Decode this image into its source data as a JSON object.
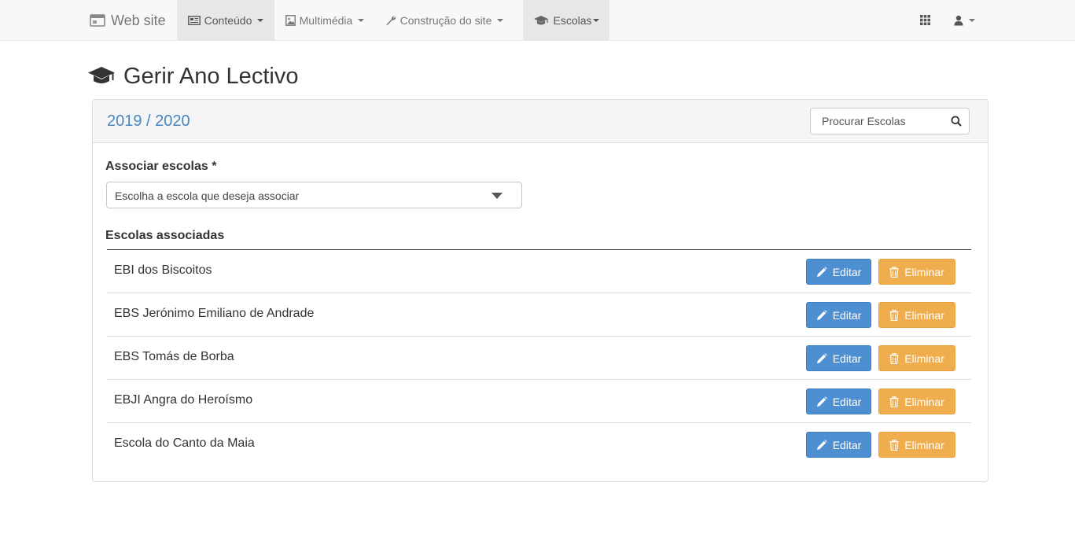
{
  "navbar": {
    "brand": {
      "label": "Web site",
      "icon": "window-icon"
    },
    "items": [
      {
        "label": "Conteúdo",
        "icon": "newspaper-icon",
        "active": true
      },
      {
        "label": "Multimédia",
        "icon": "image-icon",
        "active": false
      },
      {
        "label": "Construção do site",
        "icon": "wrench-icon",
        "active": false
      },
      {
        "label": "Escolas",
        "icon": "graduation-cap-icon",
        "active": true
      }
    ],
    "right": {
      "apps_icon": "grid-icon",
      "user_icon": "user-icon"
    }
  },
  "page": {
    "title": "Gerir Ano Lectivo",
    "title_icon": "graduation-cap-icon"
  },
  "panel": {
    "year": "2019 / 2020",
    "search": {
      "placeholder": "Procurar Escolas",
      "value": "",
      "icon": "search-icon"
    },
    "associate": {
      "label": "Associar escolas *",
      "select_value": "Escolha a escola que deseja associar"
    },
    "schools_heading": "Escolas associadas",
    "schools": [
      {
        "name": "EBI dos Biscoitos"
      },
      {
        "name": "EBS Jerónimo Emiliano de Andrade"
      },
      {
        "name": "EBS Tomás de Borba"
      },
      {
        "name": "EBJI Angra do Heroísmo"
      },
      {
        "name": "Escola do Canto da Maia"
      }
    ],
    "edit_label": "Editar",
    "delete_label": "Eliminar"
  },
  "colors": {
    "primary": "#4d8fd1",
    "warning": "#f0ad4e",
    "year": "#4a86c0",
    "navbar_bg": "#f8f8f8"
  }
}
